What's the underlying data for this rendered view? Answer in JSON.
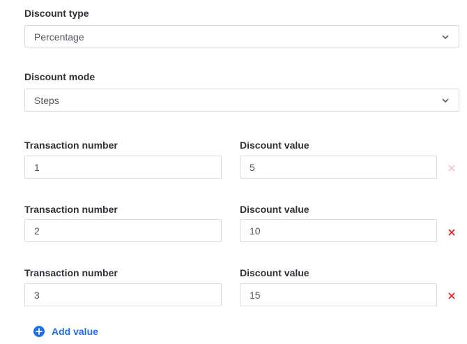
{
  "discount_type": {
    "label": "Discount type",
    "selected": "Percentage"
  },
  "discount_mode": {
    "label": "Discount mode",
    "selected": "Steps"
  },
  "steps": [
    {
      "transaction_label": "Transaction number",
      "transaction_value": "1",
      "discount_label": "Discount value",
      "discount_value": "5",
      "removable": false
    },
    {
      "transaction_label": "Transaction number",
      "transaction_value": "2",
      "discount_label": "Discount value",
      "discount_value": "10",
      "removable": true
    },
    {
      "transaction_label": "Transaction number",
      "transaction_value": "3",
      "discount_label": "Discount value",
      "discount_value": "15",
      "removable": true
    }
  ],
  "add_value": {
    "label": "Add value",
    "icon": "plus-circle-icon"
  },
  "colors": {
    "accent": "#1f6fe5",
    "remove_active": "#e02424",
    "remove_disabled": "#f4c6c6",
    "border": "#d9dce1"
  }
}
